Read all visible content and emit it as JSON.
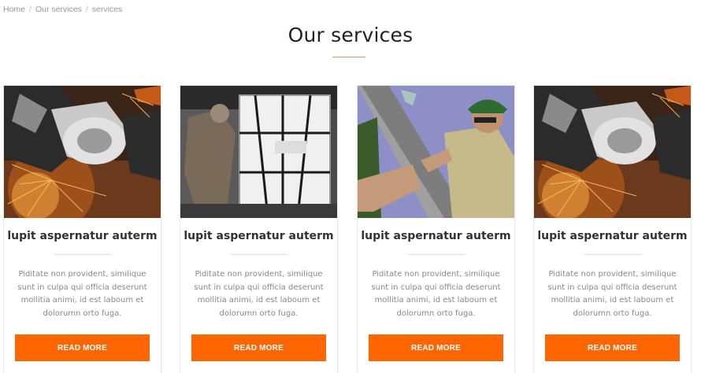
{
  "breadcrumb": {
    "items": [
      "Home",
      "Our services",
      "services"
    ],
    "separator": "/"
  },
  "page": {
    "title": "Our services"
  },
  "colors": {
    "accent": "#ff6600",
    "title_rule": "#c9a06a"
  },
  "services": [
    {
      "image": "welder-grinder-sparks-photo",
      "title": "lupit aspernatur auterm",
      "text": "Piditate non provident, similique sunt in culpa qui officia deserunt mollitia animi, id est laboum et dolorumn orto fuga.",
      "button_label": "Read more"
    },
    {
      "image": "warehouse-worker-pallet-photo",
      "title": "lupit aspernatur auterm",
      "text": "Piditate non provident, similique sunt in culpa qui officia deserunt mollitia animi, id est laboum et dolorumn orto fuga.",
      "button_label": "Read more"
    },
    {
      "image": "construction-workers-beam-photo",
      "title": "lupit aspernatur auterm",
      "text": "Piditate non provident, similique sunt in culpa qui officia deserunt mollitia animi, id est laboum et dolorumn orto fuga.",
      "button_label": "Read more"
    },
    {
      "image": "welder-grinder-sparks-photo",
      "title": "lupit aspernatur auterm",
      "text": "Piditate non provident, similique sunt in culpa qui officia deserunt mollitia animi, id est laboum et dolorumn orto fuga.",
      "button_label": "Read more"
    }
  ]
}
